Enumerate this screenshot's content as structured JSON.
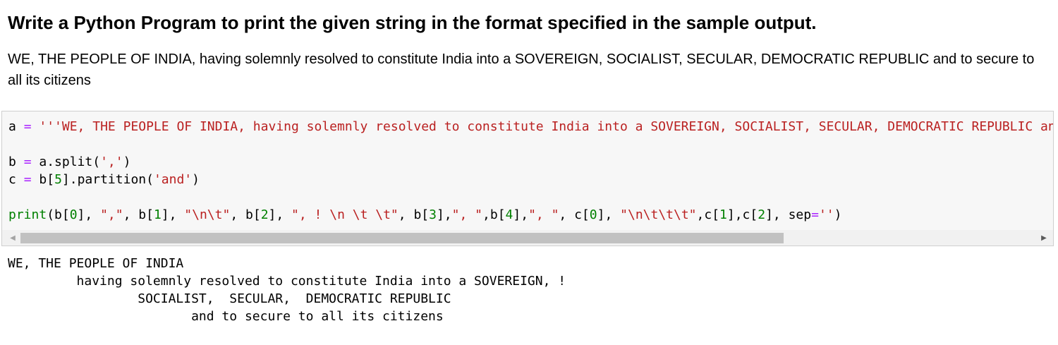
{
  "heading": "Write a Python Program to print the given string in the format specified in the sample output.",
  "description": "WE, THE PEOPLE OF INDIA, having solemnly resolved to constitute India into a SOVEREIGN, SOCIALIST, SECULAR, DEMOCRATIC REPUBLIC and to secure to all its citizens",
  "code": {
    "line1": {
      "var": "a",
      "op": "=",
      "string": "'''WE, THE PEOPLE OF INDIA, having solemnly resolved to constitute India into a SOVEREIGN, SOCIALIST, SECULAR, DEMOCRATIC REPUBLIC and to secure to all its citizens'''"
    },
    "line2": {
      "var": "b",
      "op": "=",
      "call": "a.split(",
      "arg": "','",
      "close": ")"
    },
    "line3": {
      "var": "c",
      "op": "=",
      "pre": "b[",
      "num": "5",
      "mid": "].partition(",
      "arg": "'and'",
      "close": ")"
    },
    "line4": {
      "fn": "print",
      "p1": "(b[",
      "n0": "0",
      "p2": "], ",
      "s1": "\",\"",
      "p3": ", b[",
      "n1": "1",
      "p4": "], ",
      "s2": "\"\\n\\t\"",
      "p5": ", b[",
      "n2": "2",
      "p6": "], ",
      "s3": "\", ! \\n \\t \\t\"",
      "p7": ", b[",
      "n3": "3",
      "p8": "],",
      "s4": "\", \"",
      "p9": ",b[",
      "n4": "4",
      "p10": "],",
      "s5": "\", \"",
      "p11": ", c[",
      "n5": "0",
      "p12": "], ",
      "s6": "\"\\n\\t\\t\\t\"",
      "p13": ",c[",
      "n6": "1",
      "p14": "],c[",
      "n7": "2",
      "p15": "], sep",
      "eq": "=",
      "s7": "''",
      "p16": ")"
    }
  },
  "output": {
    "line1": "WE, THE PEOPLE OF INDIA",
    "line2": "         having solemnly resolved to constitute India into a SOVEREIGN, !",
    "line3": "                 SOCIALIST,  SECULAR,  DEMOCRATIC REPUBLIC",
    "line4": "                        and to secure to all its citizens"
  },
  "colors": {
    "string": "#ba2121",
    "operator": "#aa22ff",
    "number": "#008000",
    "builtin": "#008000",
    "cell_background": "#f7f7f7"
  },
  "icons": {
    "scroll_left": "◀",
    "scroll_right": "▶"
  }
}
